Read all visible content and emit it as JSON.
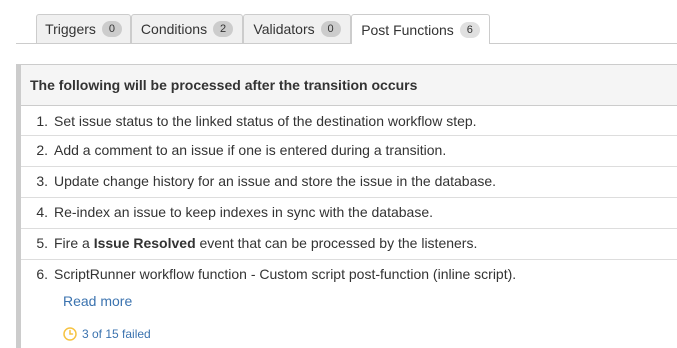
{
  "tabs": [
    {
      "label": "Triggers",
      "count": "0"
    },
    {
      "label": "Conditions",
      "count": "2"
    },
    {
      "label": "Validators",
      "count": "0"
    },
    {
      "label": "Post Functions",
      "count": "6"
    }
  ],
  "active_tab": "Post Functions",
  "panel": {
    "header": "The following will be processed after the transition occurs",
    "items": [
      {
        "num": "1.",
        "text": "Set issue status to the linked status of the destination workflow step."
      },
      {
        "num": "2.",
        "text": "Add a comment to an issue if one is entered during a transition."
      },
      {
        "num": "3.",
        "text": "Update change history for an issue and store the issue in the database."
      },
      {
        "num": "4.",
        "text": "Re-index an issue to keep indexes in sync with the database."
      },
      {
        "num": "5.",
        "text_before": "Fire a ",
        "text_bold": "Issue Resolved",
        "text_after": " event that can be processed by the listeners."
      },
      {
        "num": "6.",
        "text": "ScriptRunner workflow function - Custom script post-function (inline script).",
        "read_more": "Read more",
        "status": "3 of 15 failed",
        "status_icon": "clock-icon",
        "status_color": "#f6c342"
      }
    ]
  }
}
